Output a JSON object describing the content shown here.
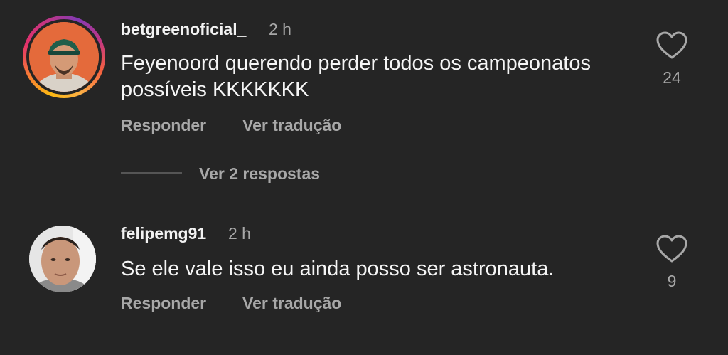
{
  "comments": [
    {
      "username": "betgreenoficial_",
      "time": "2 h",
      "text": "Feyenoord querendo perder todos os campeonatos possíveis KKKKKKK",
      "reply_label": "Responder",
      "translate_label": "Ver tradução",
      "likes": "24",
      "view_replies_label": "Ver 2 respostas",
      "avatar_ring": true
    },
    {
      "username": "felipemg91",
      "time": "2 h",
      "text": "Se ele vale isso eu ainda posso ser astronauta.",
      "reply_label": "Responder",
      "translate_label": "Ver tradução",
      "likes": "9"
    }
  ],
  "colors": {
    "background": "#252525",
    "text": "#f5f5f5",
    "muted": "#a8a8a8"
  },
  "icons": {
    "like": "heart-outline-icon"
  }
}
